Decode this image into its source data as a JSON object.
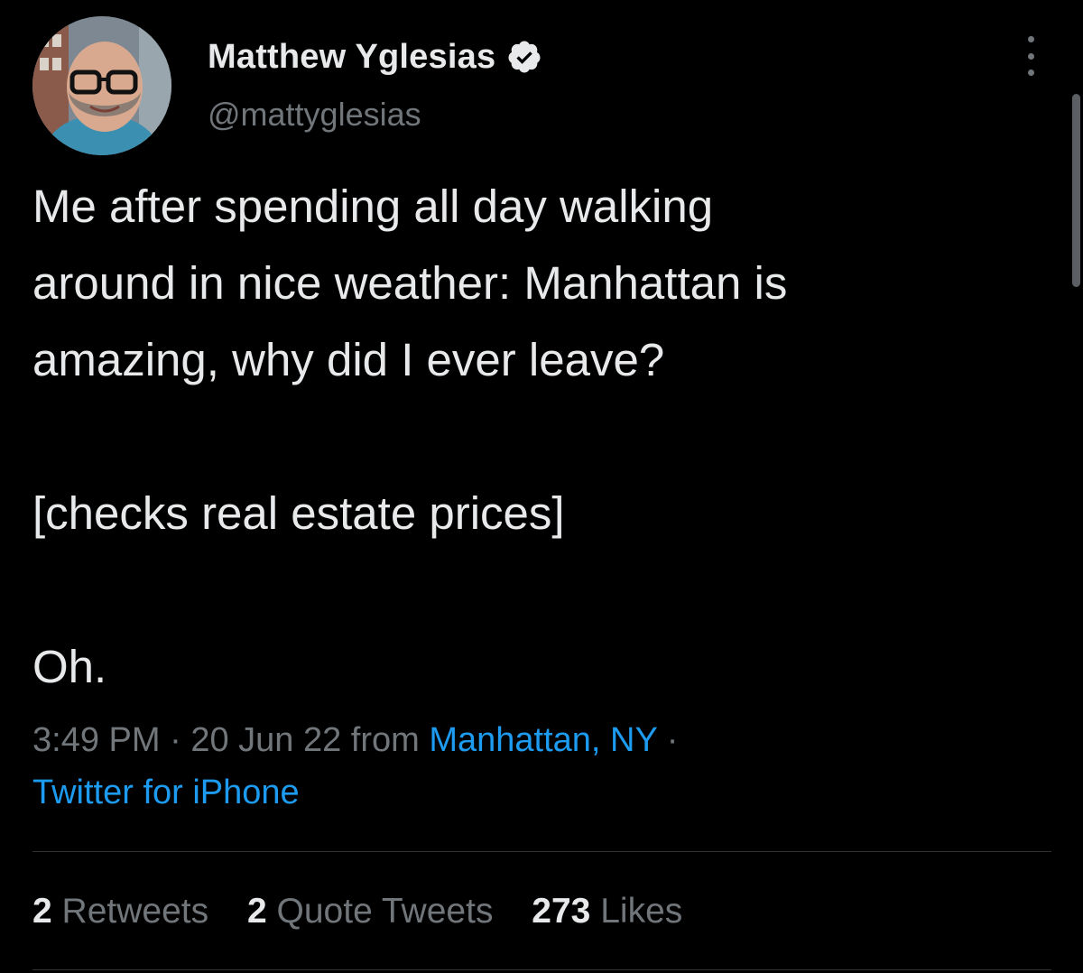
{
  "author": {
    "display_name": "Matthew Yglesias",
    "handle": "@mattyglesias",
    "verified": true,
    "avatar": "avatar"
  },
  "icons": {
    "verified": "verified-badge-icon",
    "more": "more-options-icon"
  },
  "tweet": {
    "lines": [
      "Me after spending all day walking",
      "around in nice weather: Manhattan is",
      "amazing, why did I ever leave?",
      "",
      "[checks real estate prices]",
      "",
      "Oh."
    ]
  },
  "meta": {
    "time": "3:49 PM",
    "separator": "·",
    "date": "20 Jun 22",
    "from": "from",
    "location": "Manhattan, NY",
    "source": "Twitter for iPhone"
  },
  "stats": {
    "retweets_count": "2",
    "retweets_label": "Retweets",
    "quotes_count": "2",
    "quotes_label": "Quote Tweets",
    "likes_count": "273",
    "likes_label": "Likes"
  },
  "colors": {
    "background": "#000000",
    "text": "#e7e9ea",
    "secondary": "#71767b",
    "link": "#1d9bf0",
    "divider": "#2f3336"
  }
}
